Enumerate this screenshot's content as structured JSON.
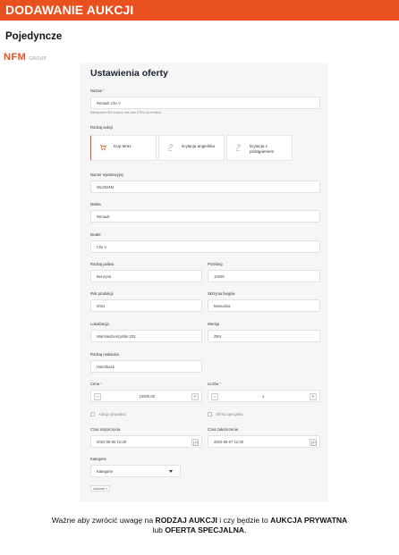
{
  "header": {
    "title": "DODAWANIE AUKCJI"
  },
  "subtitle": "Pojedyncze",
  "logo": {
    "main": "NFM",
    "sub": "GROUP"
  },
  "form": {
    "title": "Ustawienia oferty",
    "name": {
      "label": "Nazwa",
      "required_mark": "*",
      "value": "Renault Clio V",
      "hint": "Maksymalnie 500 znaków, bez kodu HTML lub emotikon"
    },
    "auction_type": {
      "label": "Rodzaj aukcji",
      "options": [
        {
          "label": "Kup teraz",
          "icon": "cart-icon",
          "selected": true
        },
        {
          "label": "licytacja angielska",
          "icon": "gavel-icon",
          "selected": false
        },
        {
          "label": "licytacja z postąpieniem",
          "icon": "gavel-icon",
          "selected": false
        }
      ]
    },
    "registration": {
      "label": "Numer rejestracyjny",
      "value": "WL0024M"
    },
    "brand": {
      "label": "Marka",
      "value": "Renault"
    },
    "model": {
      "label": "Model",
      "value": "Clio V"
    },
    "fuel": {
      "label": "Rodzaj paliwa",
      "value": "Benzyna"
    },
    "mileage": {
      "label": "Przebieg",
      "value": "10000"
    },
    "year": {
      "label": "Rok produkcji",
      "value": "2021"
    },
    "gearbox": {
      "label": "Skrzynia biegów",
      "value": "Manualna"
    },
    "location": {
      "label": "Lokalizacja",
      "value": "Wał Miedzeszyński 202"
    },
    "version": {
      "label": "Wersja",
      "value": "ZEN"
    },
    "drive": {
      "label": "Rodzaj nadwozia",
      "value": "Hatchback"
    },
    "price": {
      "label": "Cena",
      "required_mark": "*",
      "value": "10000,00",
      "minus": "−",
      "plus": "+"
    },
    "quantity": {
      "label": "Liczba",
      "required_mark": "*",
      "value": "1",
      "minus": "−",
      "plus": "+"
    },
    "private_auction": {
      "label": "Aukcja prywatna",
      "checked": false
    },
    "special_offer": {
      "label": "Oferta specjalna",
      "checked": false
    },
    "start_time": {
      "label": "Czas rozpoczęcia",
      "value": "2022-05-05 12:30"
    },
    "end_time": {
      "label": "Czas zakończenia",
      "value": "2022-05-07 12:30"
    },
    "category": {
      "label": "Kategorie",
      "value": "Kategorie",
      "chip": "osobowe",
      "chip_remove": "×"
    }
  },
  "note": {
    "part1": "Ważne aby zwrócić uwagę na ",
    "bold1": "RODZAJ AUKCJI",
    "part2": " i czy będzie to ",
    "bold2": "AUKCJA PRYWATNA",
    "part3": " lub ",
    "bold3": "OFERTA SPECJALNA",
    "part4": "."
  },
  "colors": {
    "accent": "#e8501f",
    "panel": "#f6f6f6"
  }
}
